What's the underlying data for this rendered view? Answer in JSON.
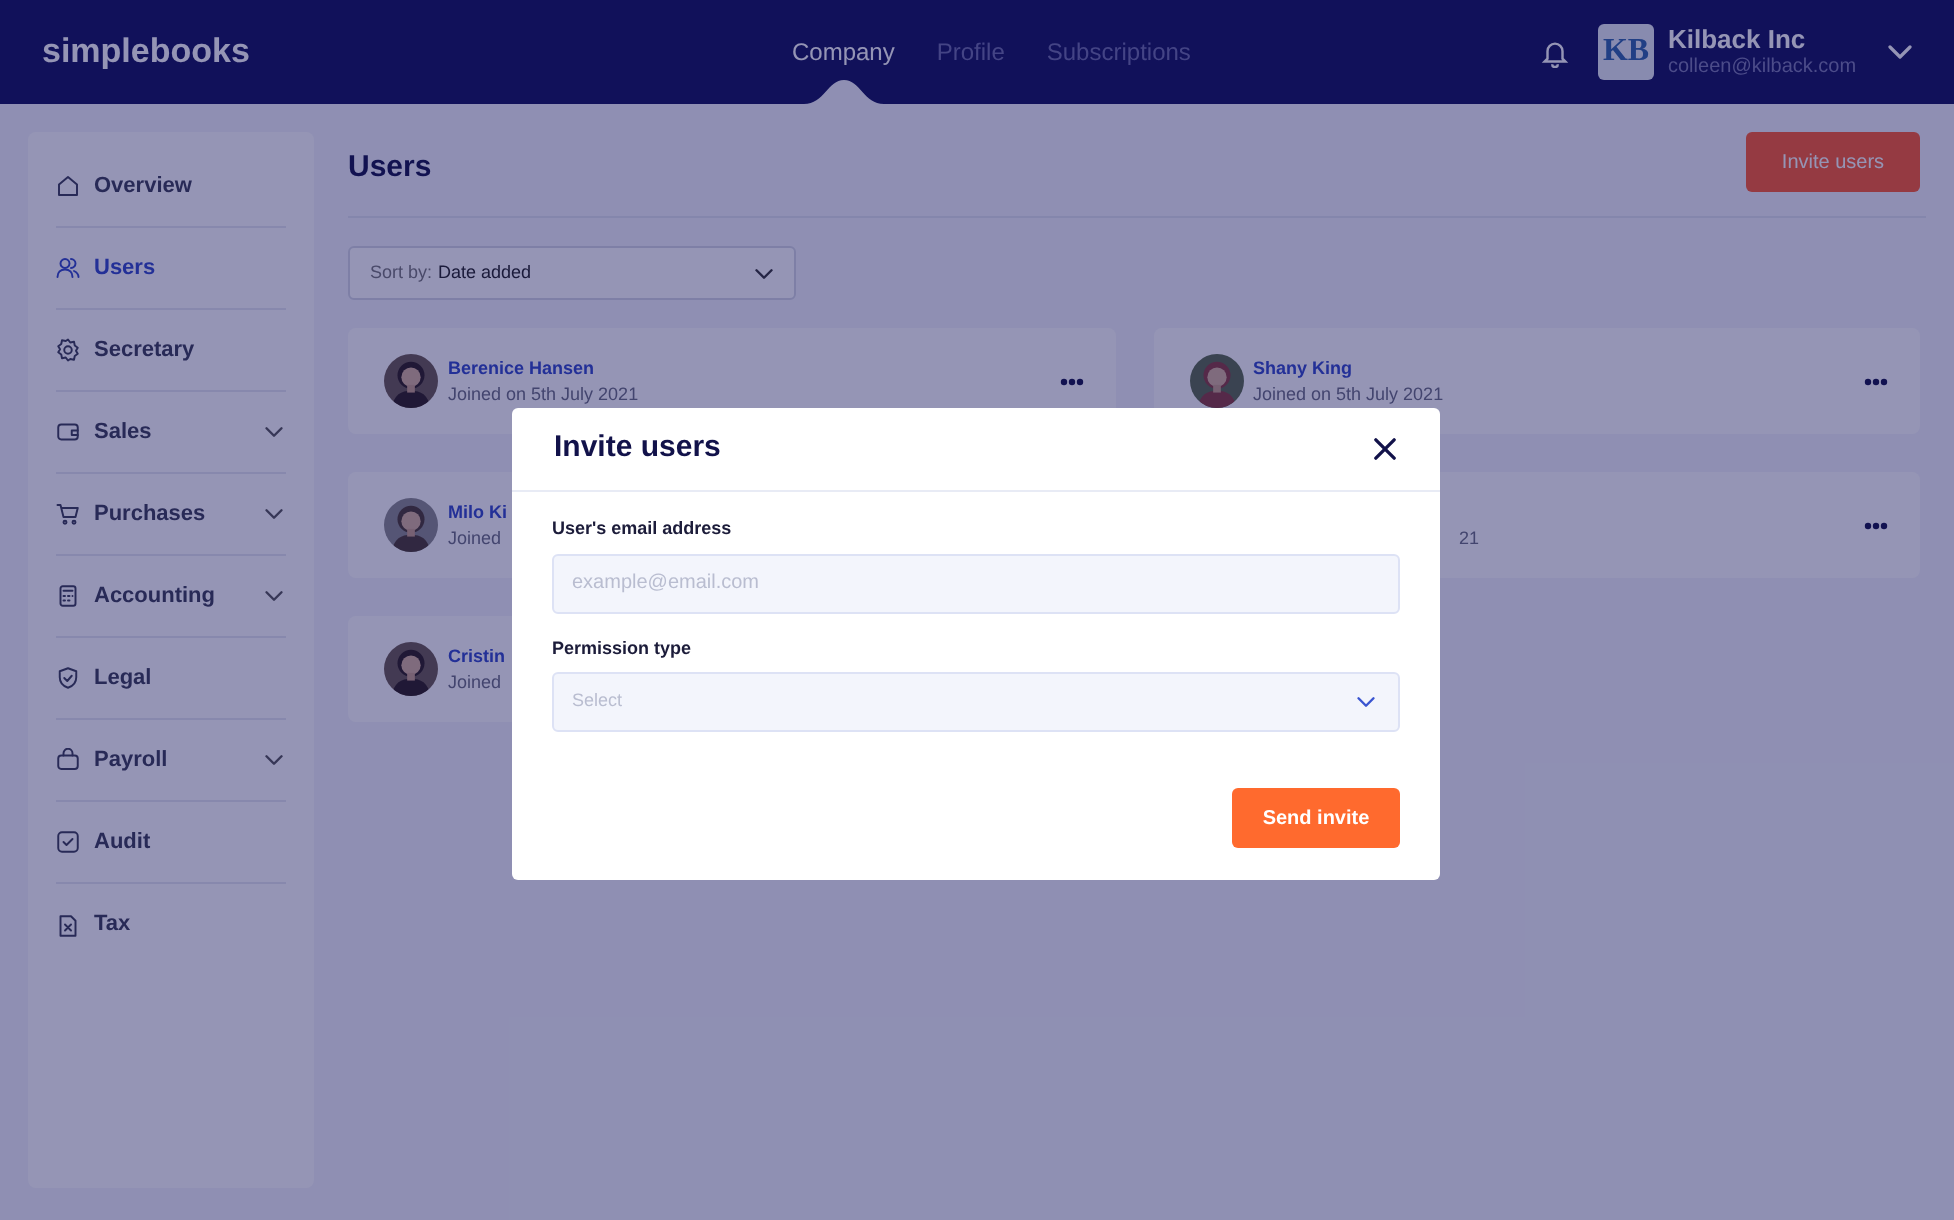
{
  "header": {
    "logo": "simplebooks",
    "nav": [
      {
        "label": "Company",
        "selected": true
      },
      {
        "label": "Profile",
        "selected": false
      },
      {
        "label": "Subscriptions",
        "selected": false
      }
    ],
    "account": {
      "initials": "KB",
      "name": "Kilback Inc",
      "email": "colleen@kilback.com"
    }
  },
  "sidebar": {
    "items": [
      {
        "label": "Overview",
        "selected": false,
        "expandable": false
      },
      {
        "label": "Users",
        "selected": true,
        "expandable": false
      },
      {
        "label": "Secretary",
        "selected": false,
        "expandable": false
      },
      {
        "label": "Sales",
        "selected": false,
        "expandable": true
      },
      {
        "label": "Purchases",
        "selected": false,
        "expandable": true
      },
      {
        "label": "Accounting",
        "selected": false,
        "expandable": true
      },
      {
        "label": "Legal",
        "selected": false,
        "expandable": false
      },
      {
        "label": "Payroll",
        "selected": false,
        "expandable": true
      },
      {
        "label": "Audit",
        "selected": false,
        "expandable": false
      },
      {
        "label": "Tax",
        "selected": false,
        "expandable": false
      }
    ]
  },
  "page": {
    "title": "Users",
    "invite_button": "Invite users",
    "sort": {
      "label": "Sort by:",
      "value": "Date added"
    },
    "users": [
      {
        "kind": "user",
        "name": "Berenice Hansen",
        "joined": "Joined on 5th July 2021",
        "menu": true
      },
      {
        "kind": "user",
        "name": "Shany King",
        "joined": "Joined on 5th July 2021",
        "menu": true
      },
      {
        "kind": "user",
        "name": "Milo Ki",
        "joined": "Joined"
      },
      {
        "kind": "covered",
        "joined": "21",
        "menu": true
      },
      {
        "kind": "user",
        "name": "Cristin",
        "joined": "Joined"
      }
    ]
  },
  "modal": {
    "title": "Invite users",
    "fields": [
      {
        "kind": "text",
        "label": "User's email address",
        "placeholder": "example@email.com"
      },
      {
        "kind": "select",
        "label": "Permission type",
        "placeholder": "Select"
      }
    ],
    "button": "Send invite"
  }
}
